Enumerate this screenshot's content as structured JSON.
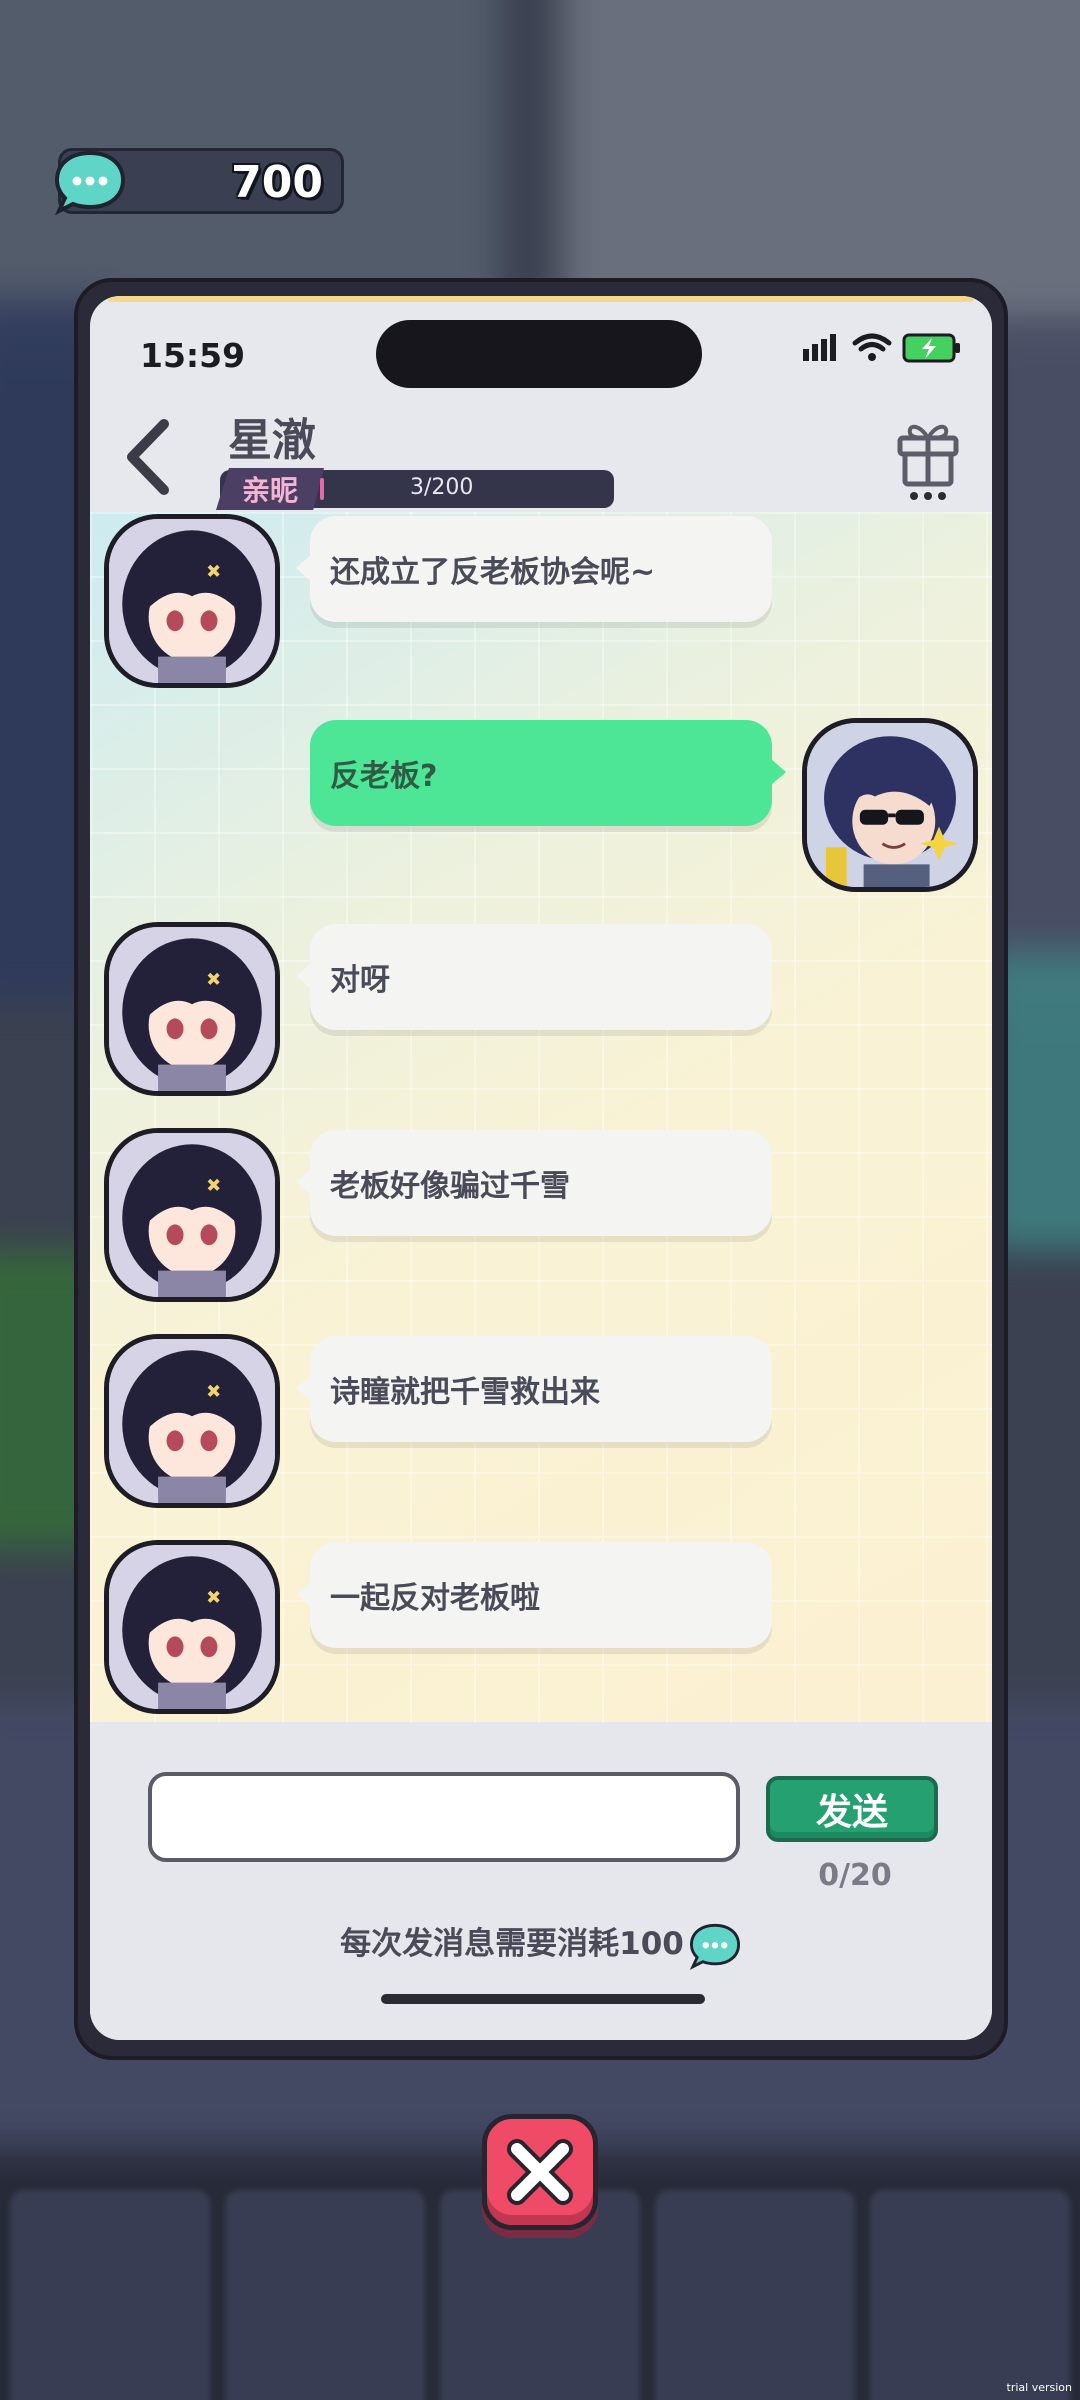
{
  "currency": {
    "amount": "700",
    "icon": "chat-bubble-coin-icon"
  },
  "status_bar": {
    "time": "15:59",
    "icons": [
      "signal-icon",
      "wifi-icon",
      "battery-charging-icon"
    ]
  },
  "chat": {
    "contact_name": "星澈",
    "intimacy": {
      "label": "亲昵",
      "value": "3/200",
      "progress": 0.015
    },
    "messages": [
      {
        "side": "left",
        "sender": "contact",
        "text": "还成立了反老板协会呢~"
      },
      {
        "side": "right",
        "sender": "player",
        "text": "反老板?"
      },
      {
        "side": "left",
        "sender": "contact",
        "text": "对呀"
      },
      {
        "side": "left",
        "sender": "contact",
        "text": "老板好像骗过千雪"
      },
      {
        "side": "left",
        "sender": "contact",
        "text": "诗瞳就把千雪救出来"
      },
      {
        "side": "left",
        "sender": "contact",
        "text": "一起反对老板啦"
      }
    ]
  },
  "composer": {
    "input_value": "",
    "input_placeholder": "",
    "send_label": "发送",
    "char_count": "0/20",
    "cost_note": "每次发消息需要消耗100"
  },
  "watermark": "trial version",
  "colors": {
    "accent_green": "#4de696",
    "send_green": "#25a071",
    "close_red": "#ef4b66",
    "intimacy_pink": "#f6b3d3"
  }
}
